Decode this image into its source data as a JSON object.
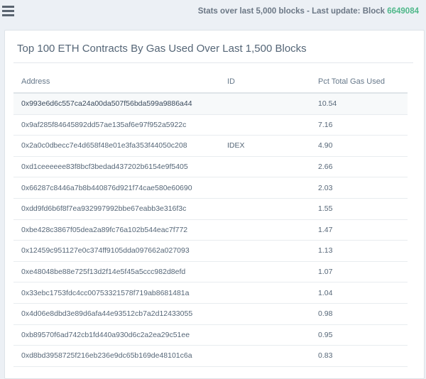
{
  "header": {
    "stats_prefix": "Stats over last 5,000 blocks - Last update: Block ",
    "block_number": "6649084"
  },
  "card": {
    "title": "Top 100 ETH Contracts By Gas Used Over Last 1,500 Blocks"
  },
  "table": {
    "columns": [
      "Address",
      "ID",
      "Pct Total Gas Used"
    ],
    "rows": [
      {
        "address": "0x993e6d6c557ca24a00da507f56bda599a9886a44",
        "id": "",
        "pct": "10.54"
      },
      {
        "address": "0x9af285f84645892dd57ae135af6e97f952a5922c",
        "id": "",
        "pct": "7.16"
      },
      {
        "address": "0x2a0c0dbecc7e4d658f48e01e3fa353f44050c208",
        "id": "IDEX",
        "pct": "4.90"
      },
      {
        "address": "0xd1ceeeeee83f8bcf3bedad437202b6154e9f5405",
        "id": "",
        "pct": "2.66"
      },
      {
        "address": "0x66287c8446a7b8b440876d921f74cae580e60690",
        "id": "",
        "pct": "2.03"
      },
      {
        "address": "0xdd9fd6b6f8f7ea932997992bbe67eabb3e316f3c",
        "id": "",
        "pct": "1.55"
      },
      {
        "address": "0xbe428c3867f05dea2a89fc76a102b544eac7f772",
        "id": "",
        "pct": "1.47"
      },
      {
        "address": "0x12459c951127e0c374ff9105dda097662a027093",
        "id": "",
        "pct": "1.13"
      },
      {
        "address": "0xe48048be88e725f13d2f14e5f45a5ccc982d8efd",
        "id": "",
        "pct": "1.07"
      },
      {
        "address": "0x33ebc1753fdc4cc00753321578f719ab8681481a",
        "id": "",
        "pct": "1.04"
      },
      {
        "address": "0x4d06e8dbd3e89d6afa44e93512cb7a2d12433055",
        "id": "",
        "pct": "0.98"
      },
      {
        "address": "0xb89570f6ad742cb1fd440a930d6c2a2ea29c51ee",
        "id": "",
        "pct": "0.95"
      },
      {
        "address": "0xd8bd3958725f216eb236e9dc65b169de48101c6a",
        "id": "",
        "pct": "0.83"
      }
    ]
  }
}
